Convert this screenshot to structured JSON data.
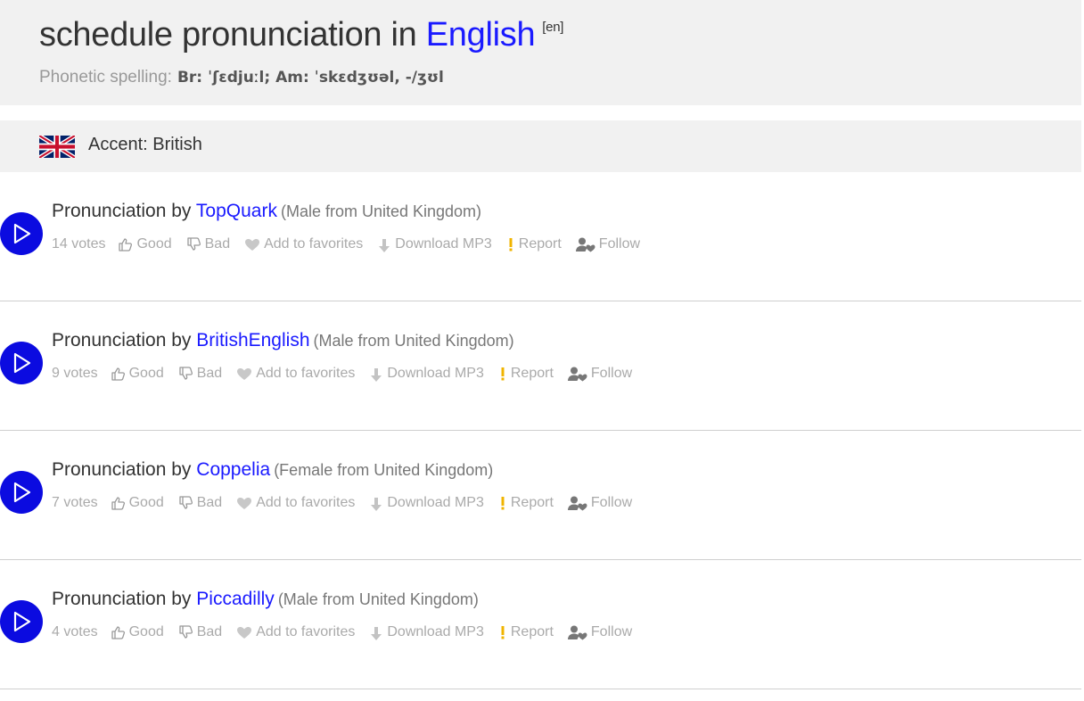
{
  "header": {
    "title_prefix": "schedule pronunciation in",
    "language": "English",
    "lang_code": "[en]",
    "phonetic_label": "Phonetic spelling:",
    "phonetic_value": "Br: ˈʃɛdjuːl; Am: ˈskɛdʒʊəl, -/ʒʊl"
  },
  "accent": {
    "flag_icon": "uk-flag-icon",
    "label": "Accent: British"
  },
  "labels": {
    "pron_by": "Pronunciation by",
    "good": "Good",
    "bad": "Bad",
    "favorites": "Add to favorites",
    "download": "Download MP3",
    "report": "Report",
    "follow": "Follow"
  },
  "entries": [
    {
      "user": "TopQuark",
      "origin": "(Male from United Kingdom)",
      "votes": "14 votes"
    },
    {
      "user": "BritishEnglish",
      "origin": "(Male from United Kingdom)",
      "votes": "9 votes"
    },
    {
      "user": "Coppelia",
      "origin": "(Female from United Kingdom)",
      "votes": "7 votes"
    },
    {
      "user": "Piccadilly",
      "origin": "(Male from United Kingdom)",
      "votes": "4 votes"
    }
  ],
  "colors": {
    "link": "#1a1aff",
    "play_button": "#0b0be0",
    "header_bg": "#f1f1f1",
    "muted_text": "#aaaaaa"
  }
}
